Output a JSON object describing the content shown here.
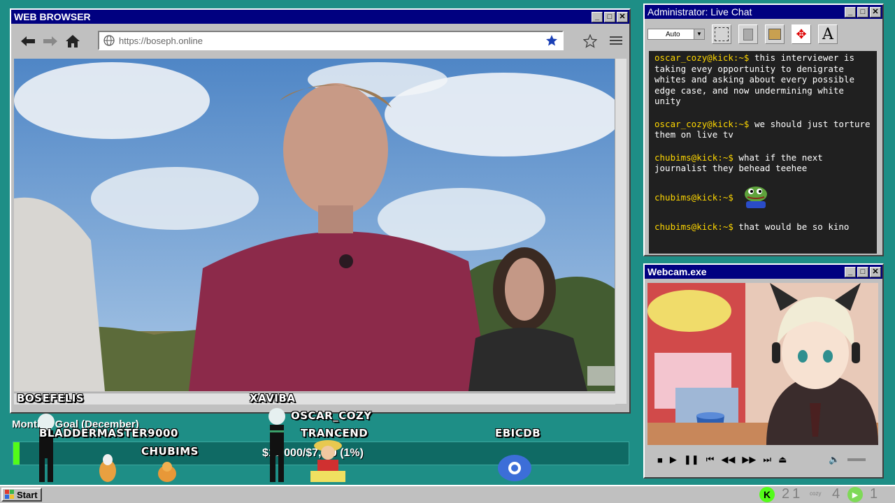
{
  "browser": {
    "title": "WEB BROWSER",
    "url": "https://boseph.online"
  },
  "chat": {
    "title": "Administrator: Live Chat",
    "font_select": "Auto",
    "messages": [
      {
        "user": "oscar_cozy@kick:~$",
        "text": "this interviewer is taking evey opportunity to denigrate whites and asking about every possible edge case, and now undermining white unity"
      },
      {
        "user": "oscar_cozy@kick:~$",
        "text": "we should just torture them on live tv"
      },
      {
        "user": "chubims@kick:~$",
        "text": "what if the next journalist they behead teehee"
      },
      {
        "user": "chubims@kick:~$",
        "text": ""
      },
      {
        "user": "chubims@kick:~$",
        "text": "that would be so kino"
      }
    ]
  },
  "webcam": {
    "title": "Webcam.exe"
  },
  "overlay": {
    "goal_label": "Monthly Goal (December)",
    "goal_amount": "$10,000/$7,...0 (1%)",
    "goal_progress_percent": 1,
    "names": [
      "BOSEFELIS",
      "XAVIBA",
      "OSCAR_COZY",
      "BLADDERMASTER9000",
      "TRANCEND",
      "EBICDB",
      "CHUBIMS"
    ]
  },
  "taskbar": {
    "start_label": "Start",
    "counter_1": "21",
    "cozy_label": "cozy",
    "counter_2": "4",
    "counter_3": "1"
  },
  "colors": {
    "desktop": "#1e8e86",
    "titlebar": "#000080",
    "chat_user": "#ffd700",
    "kick_green": "#53fc18"
  }
}
